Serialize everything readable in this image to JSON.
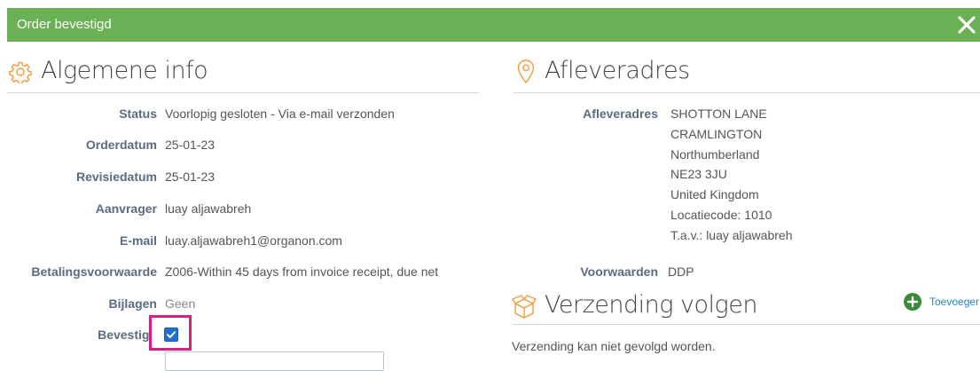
{
  "dialog": {
    "title": "Order bevestigd",
    "close_icon": "close-icon"
  },
  "colors": {
    "header": "#6ab155",
    "label": "#5b6b83",
    "accent": "#f39a3c",
    "highlight": "#d91e84",
    "link": "#2a87c7"
  },
  "general": {
    "title": "Algemene info",
    "icon": "gear-icon",
    "fields": {
      "status": {
        "label": "Status",
        "value": "Voorlopig gesloten - Via e-mail verzonden"
      },
      "orderdatum": {
        "label": "Orderdatum",
        "value": "25-01-23"
      },
      "revisiedatum": {
        "label": "Revisiedatum",
        "value": "25-01-23"
      },
      "aanvrager": {
        "label": "Aanvrager",
        "value": "luay aljawabreh"
      },
      "email": {
        "label": "E-mail",
        "value": "luay.aljawabreh1@organon.com"
      },
      "betalingsvoorwaarde": {
        "label": "Betalingsvoorwaarde",
        "value": "Z006-Within 45 days from invoice receipt, due net"
      },
      "bijlagen": {
        "label": "Bijlagen",
        "value": "Geen"
      },
      "bevestigd": {
        "label": "Bevestigd",
        "checked": true
      }
    }
  },
  "delivery": {
    "title": "Afleveradres",
    "icon": "location-pin-icon",
    "address_label": "Afleveradres",
    "address_lines": [
      "SHOTTON LANE",
      "CRAMLINGTON",
      "Northumberland",
      "NE23 3JU",
      "United Kingdom",
      "Locatiecode: 1010",
      "T.a.v.: luay aljawabreh"
    ],
    "terms_label": "Voorwaarden",
    "terms_value": "DDP"
  },
  "shipping": {
    "title": "Verzending volgen",
    "icon": "package-icon",
    "add_label": "Toevoeger",
    "message": "Verzending kan niet gevolgd worden."
  }
}
